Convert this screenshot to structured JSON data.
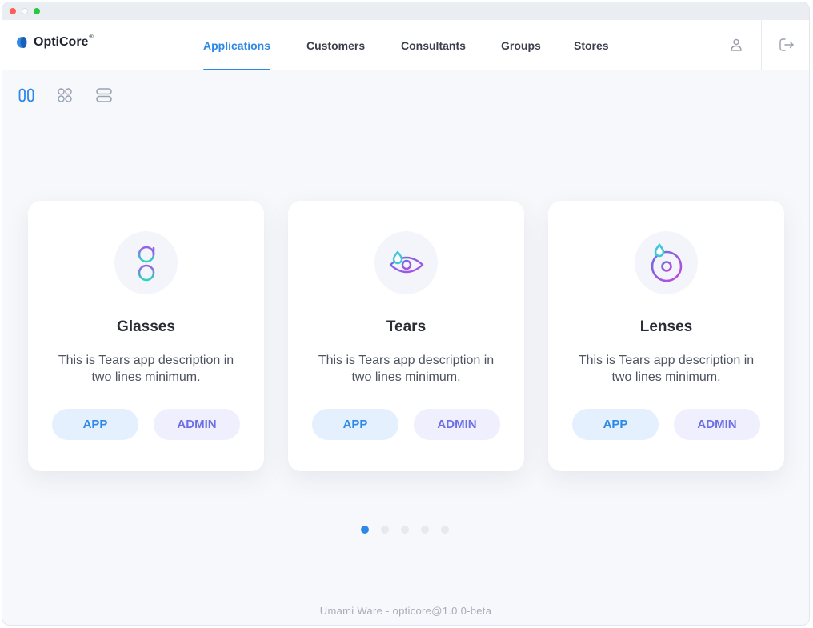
{
  "app": {
    "brand": "OptiCore",
    "brand_mark": "®",
    "accent_color": "#2f88e5",
    "admin_color": "#6b6fe3"
  },
  "nav": {
    "items": [
      {
        "label": "Applications",
        "active": true
      },
      {
        "label": "Customers",
        "active": false
      },
      {
        "label": "Consultants",
        "active": false
      },
      {
        "label": "Groups",
        "active": false
      },
      {
        "label": "Stores",
        "active": false
      }
    ]
  },
  "header_actions": [
    {
      "icon": "user-icon"
    },
    {
      "icon": "logout-icon"
    }
  ],
  "view_toggles": [
    {
      "icon": "carousel-view-icon",
      "active": true
    },
    {
      "icon": "grid-view-icon",
      "active": false
    },
    {
      "icon": "list-view-icon",
      "active": false
    }
  ],
  "cards": [
    {
      "title": "Glasses",
      "icon": "glasses-icon",
      "description": "This is Tears app description in two lines minimum.",
      "app_label": "APP",
      "admin_label": "ADMIN"
    },
    {
      "title": "Tears",
      "icon": "eye-drop-icon",
      "description": "This is Tears app description in two lines minimum.",
      "app_label": "APP",
      "admin_label": "ADMIN"
    },
    {
      "title": "Lenses",
      "icon": "lens-drop-icon",
      "description": "This is Tears app description in two lines minimum.",
      "app_label": "APP",
      "admin_label": "ADMIN"
    }
  ],
  "pagination": {
    "count": 5,
    "current": 1
  },
  "footer": "Umami Ware - opticore@1.0.0-beta"
}
